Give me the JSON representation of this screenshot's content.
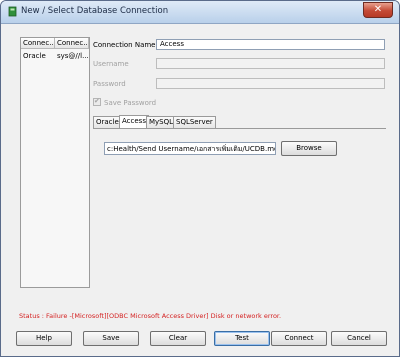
{
  "window": {
    "title": "New / Select Database Connection",
    "close_glyph": "✕"
  },
  "connections": {
    "columns": [
      "Connec...",
      "Connec..."
    ],
    "rows": [
      [
        "Oracle",
        "sys@//l..."
      ]
    ]
  },
  "form": {
    "connection_name_label": "Connection Name",
    "connection_name_value": "Access",
    "username_label": "Username",
    "password_label": "Password",
    "save_password_label": "Save Password",
    "save_password_checked": true
  },
  "tabs": [
    {
      "label": "Oracle",
      "active": false
    },
    {
      "label": "Access",
      "active": true
    },
    {
      "label": "MySQL",
      "active": false
    },
    {
      "label": "SQLServer",
      "active": false
    }
  ],
  "access": {
    "path_value": "c:Health/Send Username/เอกสารเพิ่มเติม/UCDB.mdb",
    "browse_label": "Browse"
  },
  "status": "Status : Failure -[Microsoft][ODBC Microsoft Access Driver] Disk or network error.",
  "buttons": {
    "help": "Help",
    "save": "Save",
    "clear": "Clear",
    "test": "Test",
    "connect": "Connect",
    "cancel": "Cancel"
  },
  "colors": {
    "status_text": "#d42020",
    "title_bar": "#b9d0ea",
    "close_button": "#c44a36"
  }
}
